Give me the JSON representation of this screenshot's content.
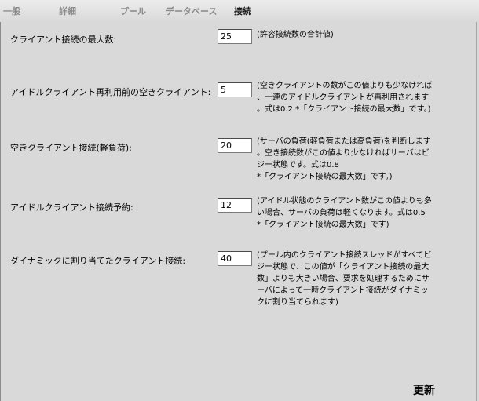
{
  "tabs": [
    {
      "label": "一般"
    },
    {
      "label": "詳細"
    },
    {
      "label": "プール"
    },
    {
      "label": "データベース"
    },
    {
      "label": "接続"
    }
  ],
  "settings": {
    "max_clients": {
      "label": "クライアント接続の最大数:",
      "value": "25",
      "description": "(許容接続数の合計値)"
    },
    "idle_reuse": {
      "label": "アイドルクライアント再利用前の空きクライアント:",
      "value": "5",
      "description": "(空きクライアントの数がこの値よりも少なければ\n、一連のアイドルクライアントが再利用されます\n。式は0.2 *「クライアント接続の最大数」です。)"
    },
    "free_light": {
      "label": "空きクライアント接続(軽負荷):",
      "value": "20",
      "description": "(サーバの負荷(軽負荷または高負荷)を判断します\n。空き接続数がこの値より少なければサーバはビ\nジー状態です。式は0.8\n*「クライアント接続の最大数」です。)"
    },
    "idle_reserve": {
      "label": "アイドルクライアント接続予約:",
      "value": "12",
      "description": "(アイドル状態のクライアント数がこの値よりも多\nい場合、サーバの負荷は軽くなります。式は0.5\n*「クライアント接続の最大数」です)"
    },
    "dynamic": {
      "label": "ダイナミックに割り当てたクライアント接続:",
      "value": "40",
      "description": "(プール内のクライアント接続スレッドがすべてビ\nジー状態で、この値が「クライアント接続の最大\n数」よりも大きい場合、要求を処理するためにサ\nーバによって一時クライアント接続がダイナミッ\nクに割り当てられます)"
    }
  },
  "actions": {
    "update_label": "更新"
  }
}
